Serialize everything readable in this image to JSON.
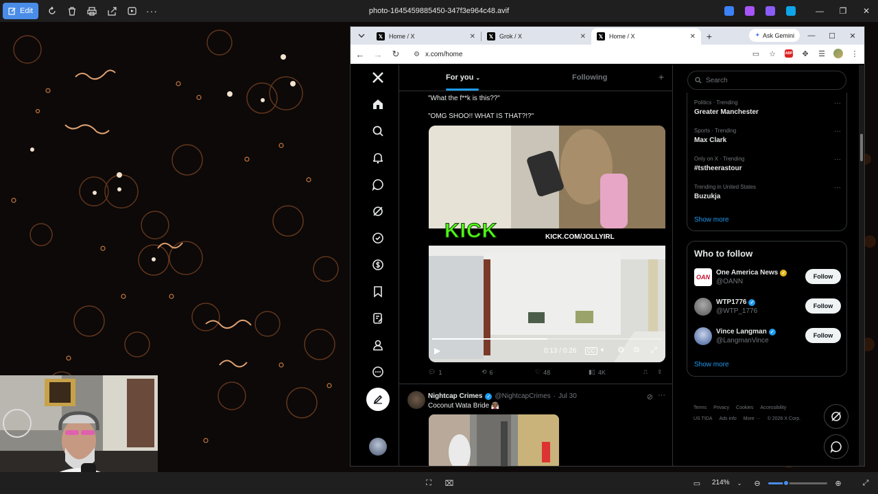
{
  "viewer": {
    "edit_label": "Edit",
    "file_name": "photo-1645459885450-347f3e964c48.avif",
    "zoom_percent": "214%",
    "zoom_level": 0.3
  },
  "browser": {
    "tabs": [
      {
        "title": "Home / X",
        "active": false
      },
      {
        "title": "Grok / X",
        "active": false
      },
      {
        "title": "Home / X",
        "active": true
      }
    ],
    "ask_gemini_label": "Ask Gemini",
    "url": "x.com/home",
    "adblock_badge": "ABP"
  },
  "x": {
    "logo": "X",
    "tabs": {
      "for_you": "For you",
      "following": "Following"
    },
    "tweet1": {
      "line1": "\"What the f**k is this??\"",
      "line2": "\"OMG SHOO!! WHAT IS THAT?!?\"",
      "banner_brand": "KICK",
      "banner_url": "KICK.COM/JOLLYIRL",
      "video_time": "0:13 / 0:26",
      "video_progress": 0.5,
      "replies": "1",
      "reposts": "6",
      "likes": "48",
      "views": "4K"
    },
    "tweet2": {
      "name": "Nightcap Crimes",
      "handle": "@NightcapCrimes",
      "dot": "·",
      "date": "Jul 30",
      "text": "Coconut Wata Bride 👰🏾"
    },
    "search_placeholder": "Search",
    "trends": [
      {
        "category": "Politics · Trending",
        "name": "Greater Manchester"
      },
      {
        "category": "Sports · Trending",
        "name": "Max Clark"
      },
      {
        "category": "Only on X · Trending",
        "name": "#tstheerastour"
      },
      {
        "category": "Trending in United States",
        "name": "Buzukja"
      }
    ],
    "trends_show_more": "Show more",
    "who_to_follow": {
      "title": "Who to follow",
      "accounts": [
        {
          "name": "One America News",
          "handle": "@OANN",
          "verified": "gold",
          "avatar_text": "OAN"
        },
        {
          "name": "WTP1776",
          "handle": "@WTP_1776",
          "verified": "blue"
        },
        {
          "name": "Vince Langman",
          "handle": "@LangmanVince",
          "verified": "blue"
        }
      ],
      "follow_label": "Follow",
      "show_more": "Show more"
    },
    "footer": {
      "links": [
        "Terms",
        "Privacy",
        "Cookies",
        "Accessibility",
        "US TIDA",
        "Ads info",
        "More ···"
      ],
      "copyright": "© 2026 X Corp."
    }
  },
  "colors": {
    "x_blue": "#1d9bf0",
    "viewer_accent": "#4a8de8",
    "kick_green": "#53fc18"
  }
}
